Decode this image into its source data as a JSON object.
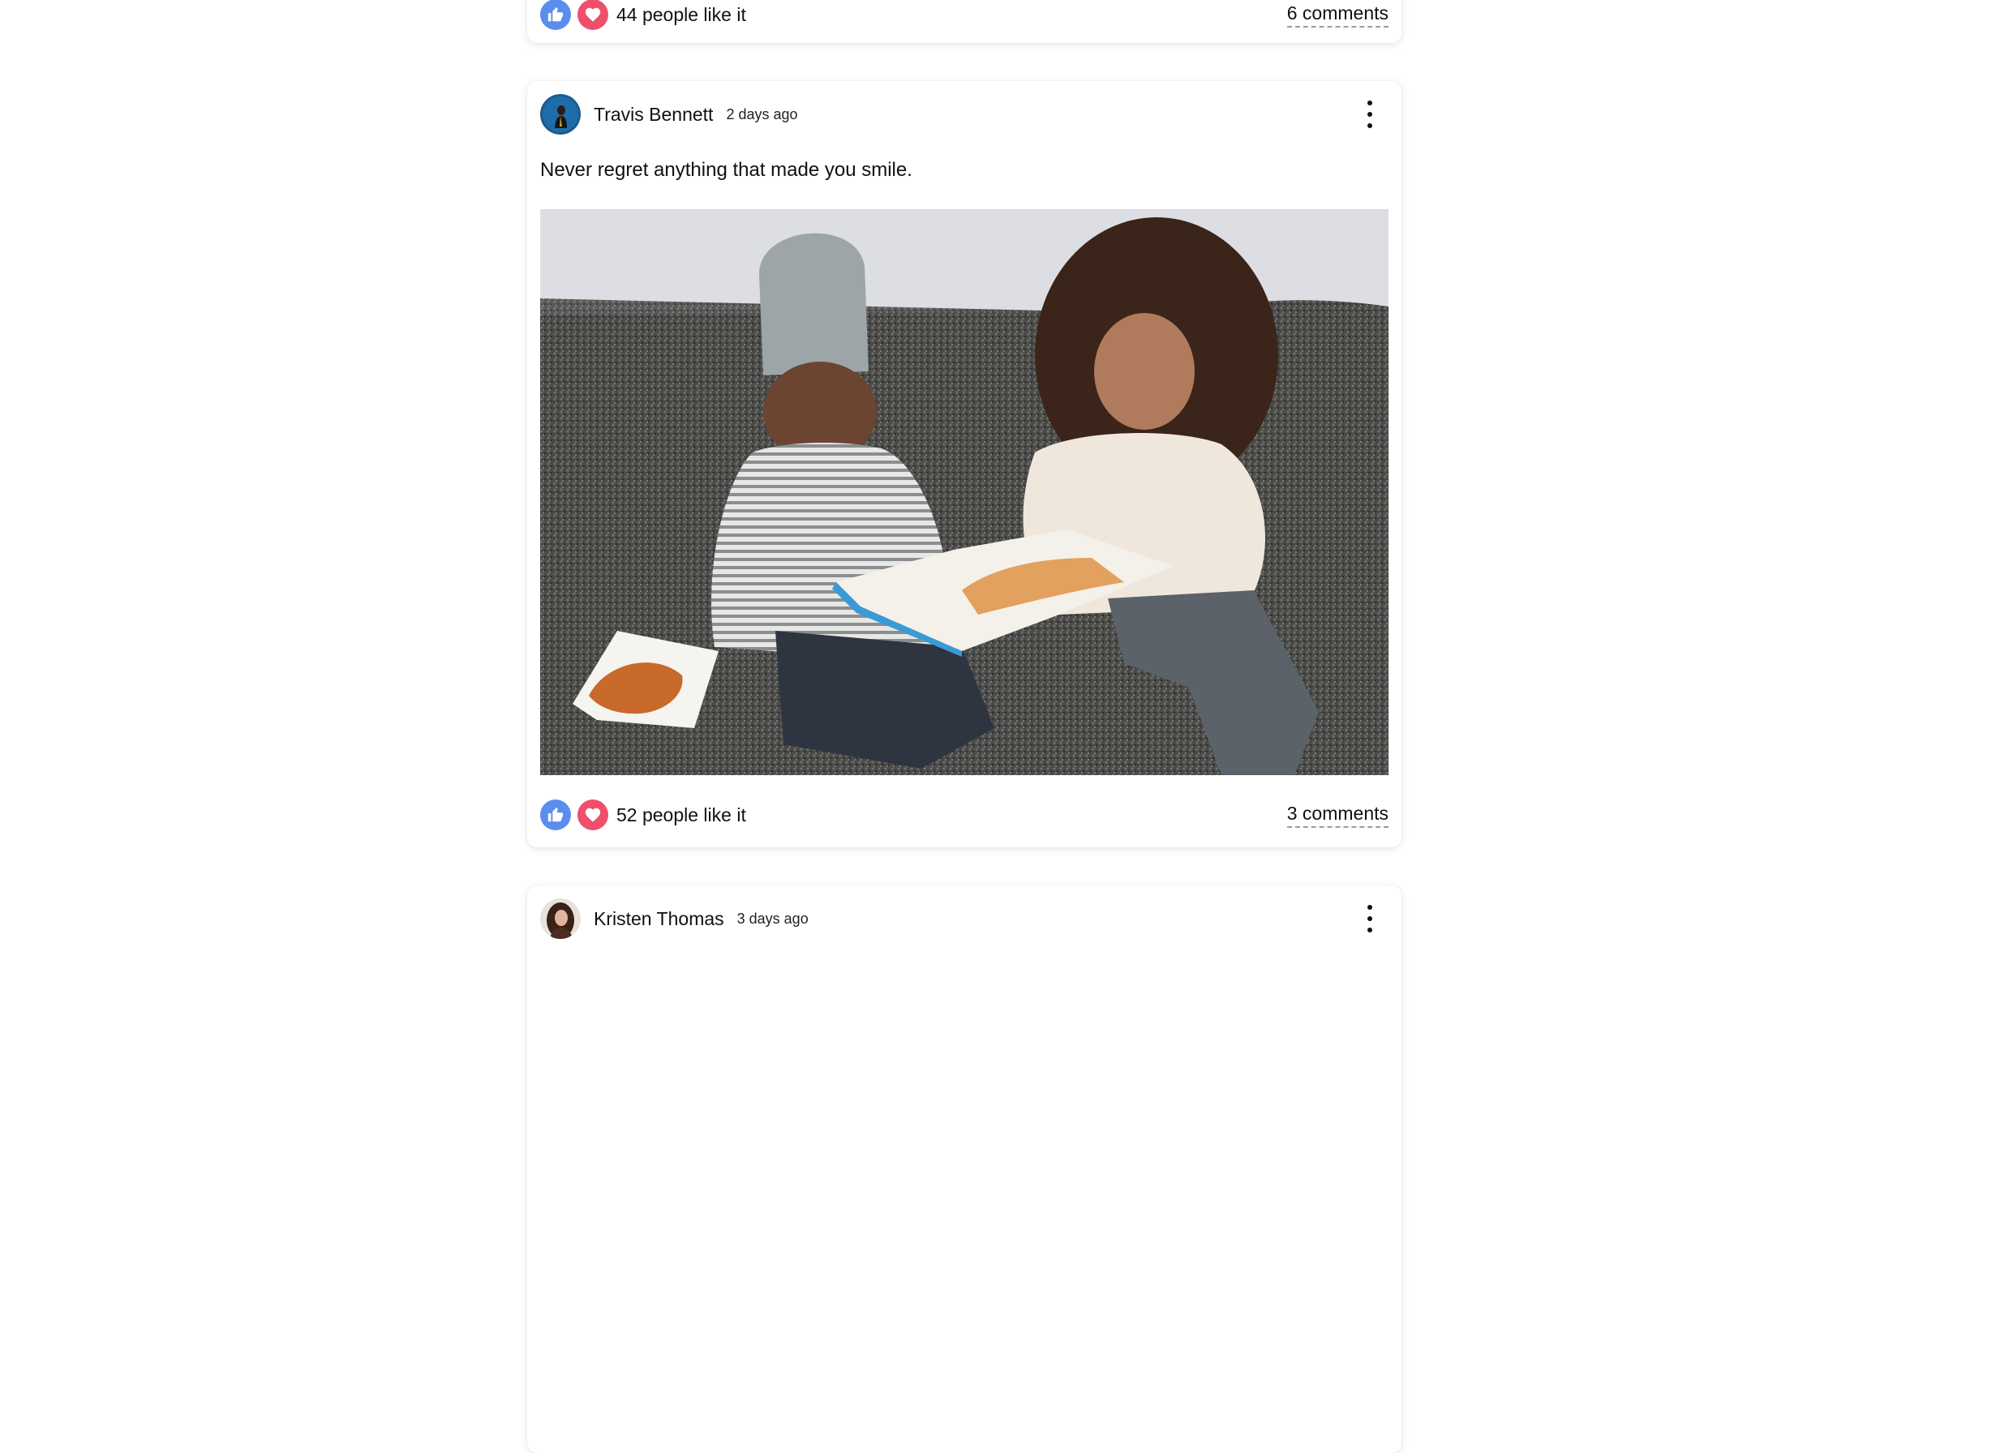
{
  "posts": [
    {
      "likes_text": "44 people like it",
      "comments_text": "6 comments"
    },
    {
      "author": "Travis Bennett",
      "time": "2 days ago",
      "text": "Never regret anything that made you smile.",
      "image_icon": "photo-children-reading-on-sofa",
      "likes_text": "52 people like it",
      "comments_text": "3 comments"
    },
    {
      "author": "Kristen Thomas",
      "time": "3 days ago"
    }
  ],
  "colors": {
    "like": "#5b8def",
    "love": "#ef4f6a",
    "card_bg": "#ffffff",
    "page_bg": "#ffffff"
  }
}
